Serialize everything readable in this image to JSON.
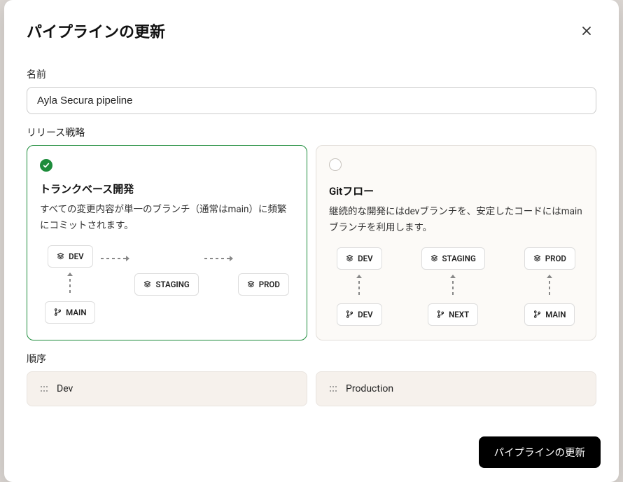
{
  "modal": {
    "title": "パイプラインの更新",
    "close_aria": "Close"
  },
  "fields": {
    "name_label": "名前",
    "name_value": "Ayla Secura pipeline",
    "strategy_label": "リリース戦略",
    "order_label": "順序"
  },
  "strategies": {
    "trunk": {
      "title": "トランクベース開発",
      "desc": "すべての変更内容が単一のブランチ（通常はmain）に頻繁にコミットされます。",
      "selected": true,
      "nodes": {
        "dev": "DEV",
        "staging": "STAGING",
        "prod": "PROD",
        "main": "MAIN"
      }
    },
    "gitflow": {
      "title": "Gitフロー",
      "desc": "継続的な開発にはdevブランチを、安定したコードにはmainブランチを利用します。",
      "selected": false,
      "nodes": {
        "dev_top": "DEV",
        "staging": "STAGING",
        "prod": "PROD",
        "dev_bottom": "DEV",
        "next": "NEXT",
        "main": "MAIN"
      }
    }
  },
  "order": [
    {
      "label": "Dev"
    },
    {
      "label": "Production"
    }
  ],
  "footer": {
    "submit_label": "パイプラインの更新"
  }
}
